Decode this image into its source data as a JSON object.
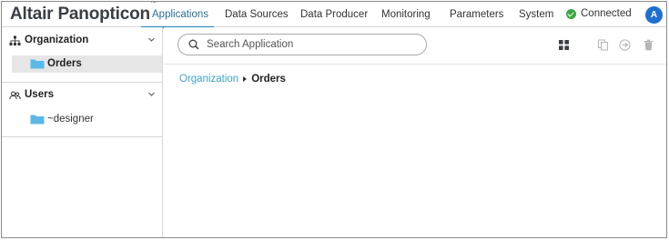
{
  "app": {
    "brand": "Altair Panopticon",
    "trademark": "™"
  },
  "nav": {
    "items": [
      {
        "label": "Applications",
        "active": true
      },
      {
        "label": "Data Sources",
        "active": false
      },
      {
        "label": "Data Producer",
        "active": false
      },
      {
        "label": "Monitoring",
        "active": false
      },
      {
        "label": "Parameters",
        "active": false
      },
      {
        "label": "System",
        "active": false
      }
    ],
    "status": {
      "label": "Connected",
      "icon": "check-circle-icon",
      "color": "#3ea644"
    },
    "avatar": {
      "initial": "A",
      "color": "#1f6fd1"
    }
  },
  "sidebar": {
    "organization": {
      "title": "Organization",
      "icon": "org-tree-icon",
      "items": [
        {
          "label": "Orders",
          "selected": true,
          "icon": "folder-icon"
        }
      ]
    },
    "users": {
      "title": "Users",
      "icon": "users-icon",
      "items": [
        {
          "label": "~designer",
          "selected": false,
          "icon": "folder-icon"
        }
      ]
    }
  },
  "main": {
    "search": {
      "placeholder": "Search Application",
      "value": ""
    },
    "toolbar": {
      "icons": [
        "grid-view-icon",
        "copy-icon",
        "move-icon",
        "delete-icon"
      ]
    },
    "breadcrumb": {
      "root": "Organization",
      "current": "Orders"
    }
  },
  "colors": {
    "accent": "#2a7fb8",
    "link": "#3fa2c8",
    "folder": "#5bb8e6",
    "selected_bg": "#e6e6e6"
  }
}
